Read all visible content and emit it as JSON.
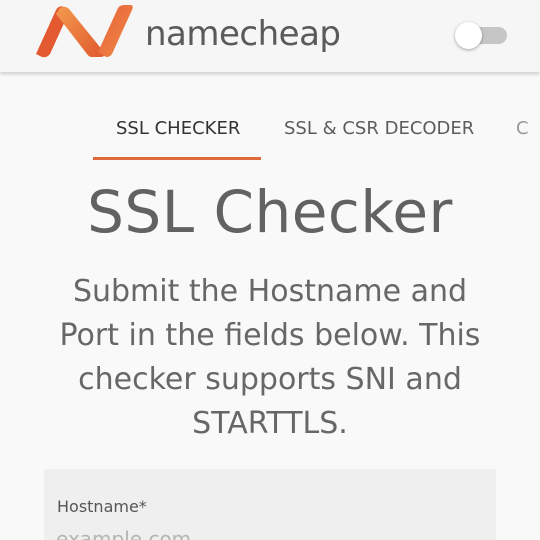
{
  "header": {
    "brand_name": "namecheap",
    "logo_icon": "namecheap-n-logo",
    "theme_toggle": {
      "state": "off"
    }
  },
  "tabs": [
    {
      "label": "SSL CHECKER",
      "active": true
    },
    {
      "label": "SSL & CSR DECODER",
      "active": false
    },
    {
      "label": "C",
      "active": false,
      "clipped": true
    }
  ],
  "main": {
    "title": "SSL Checker",
    "description": "Submit the Hostname and Port in the fields below. This checker supports SNI and STARTTLS."
  },
  "form": {
    "hostname_label": "Hostname*",
    "hostname_placeholder": "example.com",
    "hostname_value": ""
  },
  "colors": {
    "accent": "#de6b3a",
    "logo_orange_dark": "#e0582e",
    "logo_orange_light": "#f39a4e",
    "background": "#f9f9f9"
  }
}
